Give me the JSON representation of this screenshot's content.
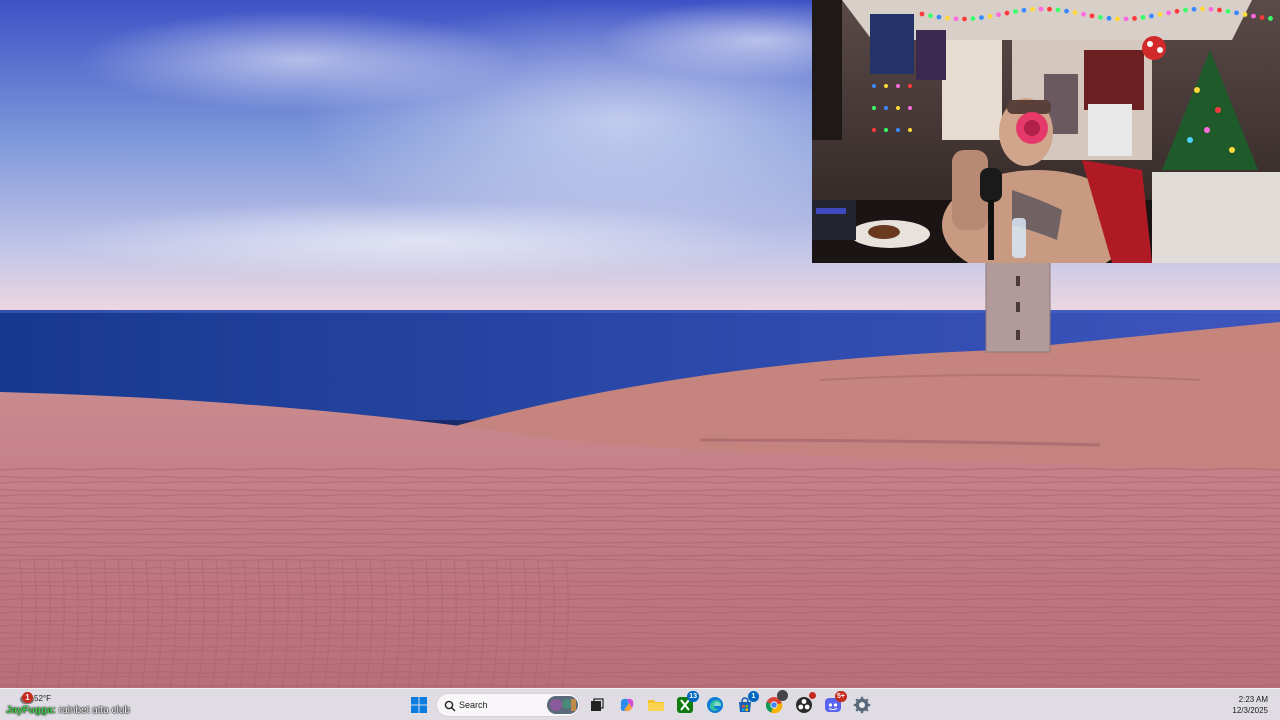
{
  "desktop": {
    "wallpaper": "rubjerg-knude-lighthouse-sand-dunes",
    "colors": {
      "sky_top": "#3f54c8",
      "sky_mid": "#8aa4dc",
      "horizon": "#e9d4df",
      "sea": "#203f9a",
      "sand": "#c07c84",
      "sand_dark": "#a3606c"
    }
  },
  "webcam": {
    "description_icon": "streamer-webcam"
  },
  "taskbar": {
    "weather": {
      "temp": "52°F",
      "badge": "1",
      "icon": "cloud-icon"
    },
    "chat": {
      "name": "JayFugga:",
      "message": "rainbet atta club"
    },
    "search": {
      "placeholder": "Search"
    },
    "apps": [
      {
        "name": "start",
        "icon": "windows-logo-icon"
      },
      {
        "name": "task-view",
        "icon": "task-view-icon"
      },
      {
        "name": "copilot",
        "icon": "copilot-icon"
      },
      {
        "name": "file-explorer",
        "icon": "folder-icon"
      },
      {
        "name": "xbox",
        "icon": "xbox-icon",
        "badge": "13"
      },
      {
        "name": "edge",
        "icon": "edge-icon"
      },
      {
        "name": "store",
        "icon": "store-icon",
        "badge": "1"
      },
      {
        "name": "chrome",
        "icon": "chrome-icon"
      },
      {
        "name": "obs",
        "icon": "obs-icon"
      },
      {
        "name": "discord",
        "icon": "discord-icon",
        "badge": "5+"
      },
      {
        "name": "settings",
        "icon": "gear-icon"
      }
    ],
    "clock": {
      "time": "2:23 AM",
      "date": "12/3/2025"
    },
    "colors": {
      "accent": "#0078d4",
      "badge_red": "#c42b1c",
      "badge_green": "#107c10",
      "badge_blue": "#0067c0"
    }
  }
}
